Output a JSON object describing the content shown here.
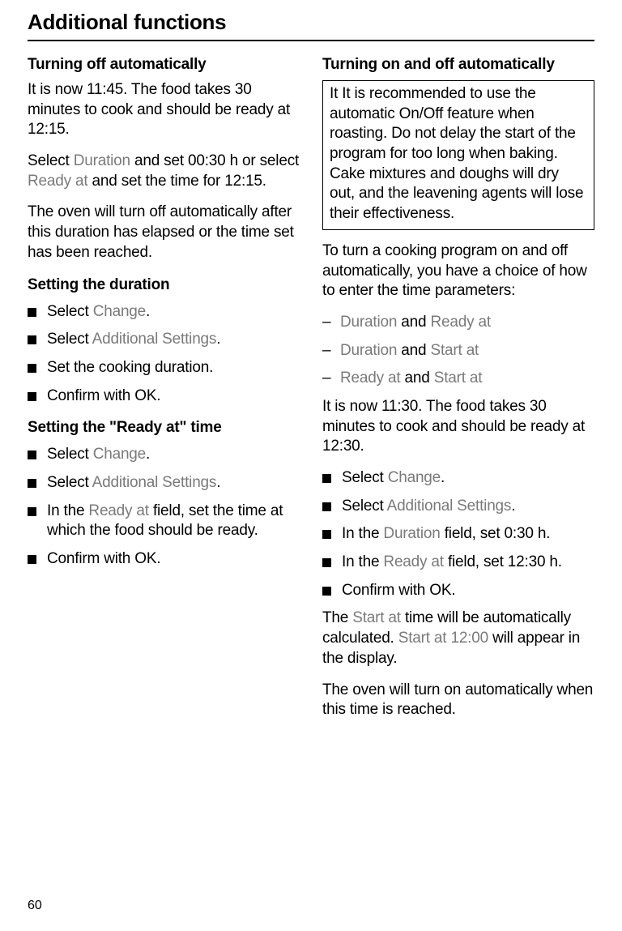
{
  "page_title": "Additional functions",
  "page_number": "60",
  "left": {
    "heading": "Turning off automatically",
    "p1a": "It is now 11:45. The food takes 30 minutes to cook and should be ready at 12:15.",
    "p2_1": "Select ",
    "p2_dur": "Duration",
    "p2_2": " and set 00:30 h or select ",
    "p2_ready": "Ready at",
    "p2_3": " and set the time for 12:15.",
    "p3": "The oven will turn off automatically after this duration has elapsed or the time set has been reached.",
    "sub1": "Setting the duration",
    "s1": {
      "a1": "Select ",
      "a2": "Change",
      "a3": ".",
      "b1": "Select ",
      "b2": "Additional Settings",
      "b3": ".",
      "c": "Set the cooking duration.",
      "d": "Confirm with OK."
    },
    "sub2": "Setting the \"Ready at\" time",
    "s2": {
      "a1": "Select ",
      "a2": "Change",
      "a3": ".",
      "b1": "Select ",
      "b2": "Additional Settings",
      "b3": ".",
      "c1": "In the ",
      "c2": "Ready at",
      "c3": " field, set the time at which the food should be ready.",
      "d": "Confirm with OK."
    }
  },
  "right": {
    "heading": "Turning on and off automatically",
    "note": "It It is recommended to use the automatic On/Off feature when roasting. Do not delay the start of the program for too long when baking. Cake mixtures and doughs will dry out, and the leavening agents will lose their effectiveness.",
    "p1": "To turn a cooking program on and off automatically, you have a choice of how to enter the time parameters:",
    "opts": {
      "a1": "Duration",
      "a2": " and ",
      "a3": "Ready at",
      "b1": "Duration",
      "b2": " and ",
      "b3": "Start at",
      "c1": "Ready at",
      "c2": " and ",
      "c3": "Start at"
    },
    "p2": "It is now 11:30. The food takes 30 minutes to cook and should be ready at 12:30.",
    "s": {
      "a1": "Select ",
      "a2": "Change",
      "a3": ".",
      "b1": "Select ",
      "b2": "Additional Settings",
      "b3": ".",
      "c1": "In the ",
      "c2": "Duration",
      "c3": " field, set 0:30 h.",
      "d1": "In the ",
      "d2": "Ready at",
      "d3": " field, set 12:30 h.",
      "e": "Confirm with OK."
    },
    "p3_1": "The ",
    "p3_2": "Start at",
    "p3_3": " time will be automatically calculated. ",
    "p3_4": "Start at 12:00",
    "p3_5": " will appear in the display.",
    "p4": "The oven will turn on automatically when this time is reached."
  }
}
